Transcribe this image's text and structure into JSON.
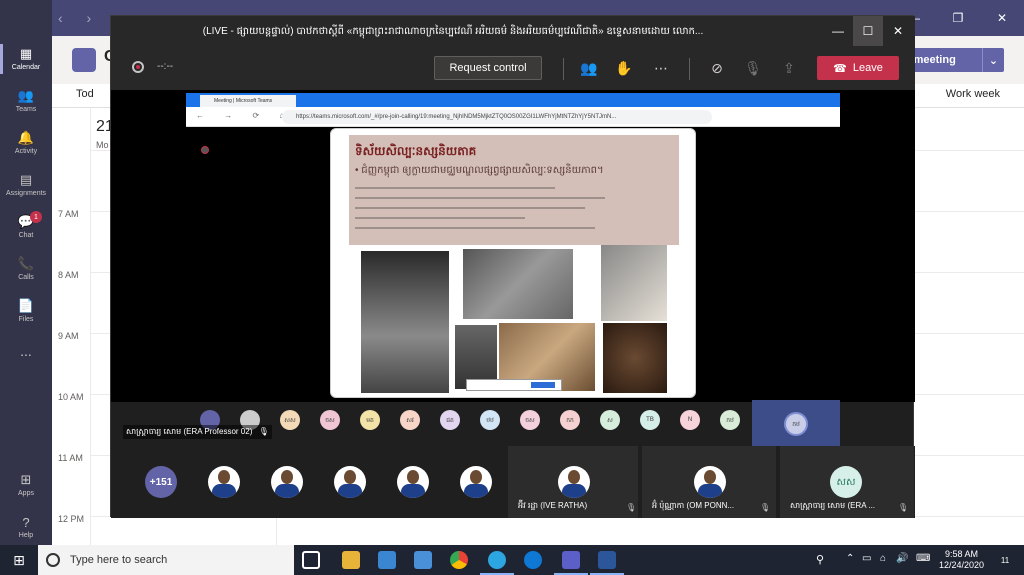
{
  "teams": {
    "rail": [
      {
        "label": "Calendar",
        "icon": "calendar-icon",
        "active": true
      },
      {
        "label": "Teams",
        "icon": "teams-icon"
      },
      {
        "label": "Activity",
        "icon": "bell-icon"
      },
      {
        "label": "Assignments",
        "icon": "assignments-icon"
      },
      {
        "label": "Chat",
        "icon": "chat-icon",
        "badge": "1"
      },
      {
        "label": "Calls",
        "icon": "phone-icon"
      },
      {
        "label": "Files",
        "icon": "file-icon"
      },
      {
        "label": "...",
        "icon": "more-icon"
      }
    ],
    "rail_bottom": [
      {
        "label": "Apps",
        "icon": "apps-icon"
      },
      {
        "label": "Help",
        "icon": "help-icon"
      }
    ],
    "calendar": {
      "title": "C",
      "new_meeting": "w meeting",
      "today": "Tod",
      "view": "Work week",
      "day_number": "21",
      "day_name": "Mo",
      "times": [
        "7 AM",
        "8 AM",
        "9 AM",
        "10 AM",
        "11 AM",
        "12 PM"
      ]
    }
  },
  "meeting": {
    "title": "(LIVE - ផ្សាយបន្តផ្ទាល់) បាឋកថាស្តីពី «កម្ពុជាព្រះរាជាណាចក្រនៃប្បវេណី អរិយធម៌ និងអរិយធម៌ប្បវេណីជាតិ» ឧទ្ទេសនាមដោយ លោក...",
    "timer": "--:--",
    "request_control": "Request control",
    "leave": "Leave",
    "presenter": "សាស្ត្រាចារ្យ សោម (ERA Professor 02)",
    "browser": {
      "tab": "Meeting | Microsoft Teams",
      "url": "https://teams.microsoft.com/_#/pre-join-calling/19:meeting_NjhINDM5MjktZTQ0OS00ZGI1LWFhYjMtNTZhYjY5NTJmN..."
    },
    "slide": {
      "title": "ទិស័យសិល្បៈនស្សនិយតាគ",
      "subtitle": "• ជំញ្ញកម្ពុជា ឲ្យក្លាយជាមជ្ឈមណ្ឌលផ្សព្វផ្សាយសិល្បៈទស្សនិយភាព។"
    },
    "strip_initials": [
      "",
      "",
      "សស",
      "ចស",
      "មត",
      "សវ",
      "ផត",
      "ឋឋ",
      "ចស",
      "កក",
      "ស",
      "TB",
      "N",
      "កឋ"
    ],
    "spotlight_initials": "កឋ",
    "gallery_count": "+151",
    "tiles": [
      {
        "name": "អ៊ីវ រដ្ឋា (IVE RATHA)"
      },
      {
        "name": "អ៊ំ ប៉ុណ្ណាកា (OM PONN..."
      },
      {
        "name": "សាស្ត្រាចារ្យ សោម (ERA ...",
        "initials": "សស"
      }
    ]
  },
  "taskbar": {
    "search_placeholder": "Type here to search",
    "time": "9:58 AM",
    "date": "12/24/2020",
    "notif_count": "11"
  }
}
